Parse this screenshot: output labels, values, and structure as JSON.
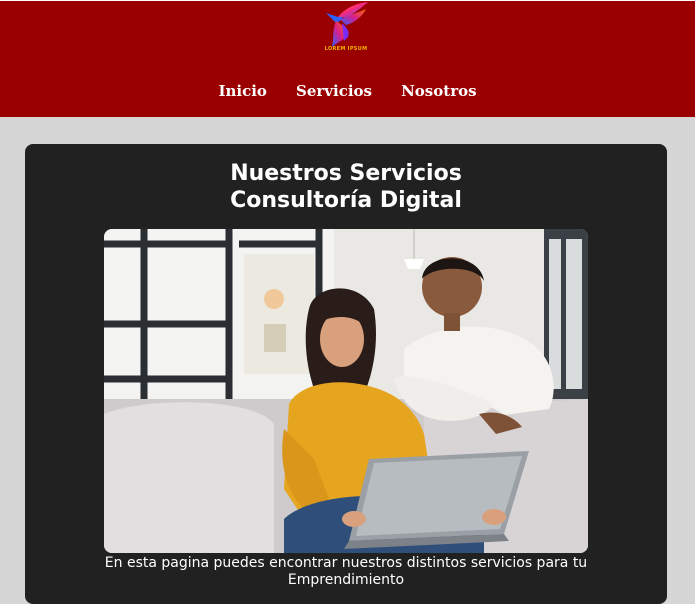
{
  "header": {
    "logo_text": "LOREM IPSUM"
  },
  "nav": {
    "items": [
      "Inicio",
      "Servicios",
      "Nosotros"
    ]
  },
  "main": {
    "title_line1": "Nuestros Servicios",
    "title_line2": "Consultoría Digital",
    "caption_line1": "En esta pagina puedes encontrar nuestros distintos servicios para tu",
    "caption_line2": "Emprendimiento"
  },
  "colors": {
    "header_bg": "#9b0000",
    "page_bg": "#d6d6d6",
    "card_bg": "#212121"
  }
}
